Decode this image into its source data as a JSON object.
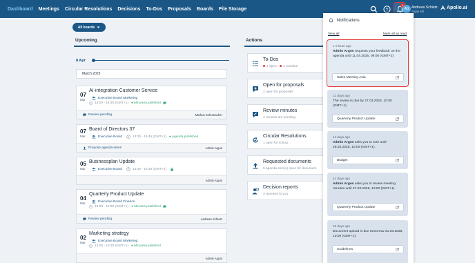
{
  "nav": {
    "items": [
      "Dashboard",
      "Meetings",
      "Circular Resolutions",
      "Decisions",
      "To-Dos",
      "Proposals",
      "Boards",
      "File Storage"
    ],
    "active": "Dashboard"
  },
  "header": {
    "user_initials": "AS",
    "user_name": "Andreas Schietz",
    "user_org": "Argos AG",
    "notification_count": "4",
    "brand": "Apollo.ai"
  },
  "board_selector": {
    "label": "All boards"
  },
  "upcoming": {
    "heading": "Upcoming",
    "timeline_label": "8 Apr",
    "month_label": "March 2025",
    "meetings": [
      {
        "day": "07",
        "month": "Mar",
        "title": "AI-integration Customer Service",
        "board": "Executive Board Marketing",
        "time": "13:00 - 16:30 (GMT+1)",
        "status": "Minutes published",
        "action": "Review pending",
        "owner": "Markus Schumacher"
      },
      {
        "day": "07",
        "month": "Mar",
        "title": "Board of Directors 37",
        "board": "Executive Board",
        "time": "13:00 - 16:45 (GMT+1)",
        "status": "Agenda published",
        "action": "Propose agenda items",
        "owner": "Admin Argos"
      },
      {
        "day": "05",
        "month": "Mar",
        "title": "Businessplan Update",
        "board": "Executive Board",
        "time": "13:00 - 18:30 (GMT+1)",
        "status": "",
        "action": "",
        "owner": "Admin Argos"
      },
      {
        "day": "04",
        "month": "Mar",
        "title": "Quarterly Product Update",
        "board": "Executive Board Finance",
        "time": "13:00 - 13:30 (GMT+1)",
        "status": "Minutes published",
        "action": "Review pending",
        "owner": "Andreas Schietz"
      },
      {
        "day": "02",
        "month": "Mar",
        "title": "Marketing strategy",
        "board": "Executive Board Marketing",
        "time": "13:00 - 19:30 (GMT+1)",
        "status": "Minutes published",
        "action": "",
        "owner": "Admin Argos"
      }
    ]
  },
  "actions": {
    "heading": "Actions",
    "items": [
      {
        "title": "To-Dos",
        "sub_a": "4 open",
        "sub_b": "4 overdue"
      },
      {
        "title": "Open for proposals",
        "sub": "2 open for proposals"
      },
      {
        "title": "Review minutes",
        "sub": "4 reviews are pending"
      },
      {
        "title": "Circular Resolutions",
        "sub": "1 open for voting"
      },
      {
        "title": "Requested documents",
        "sub": "5 agenda item(s) open for document"
      },
      {
        "title": "Decision reports",
        "sub": "3 reported to you"
      }
    ]
  },
  "notifications": {
    "heading": "Notifications",
    "view_all": "View all",
    "mark_all": "Mark all as read",
    "items": [
      {
        "time": "1 minute ago",
        "actor": "Admin Argos",
        "text": " requests your feedback on the agenda until 11.04.2025, 09:00 (GMT+2)",
        "button": "Sales Meeting Asia"
      },
      {
        "time": "12 days ago",
        "actor": "",
        "text": "The review is due by 27.03.2025, 10:00 (GMT+1)",
        "button": "Quarterly Product Update"
      },
      {
        "time": "14 days ago",
        "actor": "Admin Argos",
        "text": " asks you to vote until 26.03.2025, 10:00 (GMT+1).",
        "button": "Budget"
      },
      {
        "time": "14 days ago",
        "actor": "Admin Argos",
        "text": " asks you to review meeting minutes until 27.03.2025, 10:00 (GMT+1).",
        "button": "Quarterly Product Update"
      },
      {
        "time": "18 days ago",
        "actor": "",
        "text": "Document upload is due tomorrow 21.03.2025, 10:00 (GMT+1)",
        "button": "Guidelines"
      }
    ]
  },
  "colors": {
    "primary": "#1b5786",
    "accent_active": "#7fc8f0",
    "highlight": "#e53935",
    "status_green": "#3aa77a"
  }
}
